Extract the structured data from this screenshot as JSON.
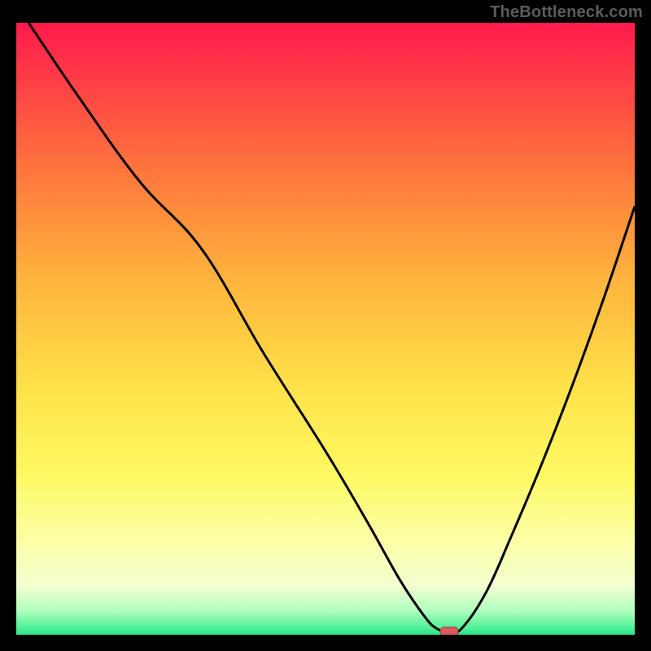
{
  "watermark": "TheBottleneck.com",
  "colors": {
    "bg_black": "#000000",
    "watermark_grey": "#5c5c5c",
    "curve": "#000000",
    "marker_fill": "#d85a5a",
    "marker_stroke": "#a83c3c",
    "grad_top": "#ff1a4d",
    "grad_mid1": "#ff6e3d",
    "grad_mid2": "#ffb43d",
    "grad_mid3": "#ffe24a",
    "grad_mid4": "#fff963",
    "grad_soft_yellow": "#fbffa8",
    "grad_pale": "#f3ffd0",
    "grad_green_soft": "#b2ffbf",
    "grad_green": "#29e888"
  },
  "chart_data": {
    "type": "line",
    "title": "",
    "xlabel": "",
    "ylabel": "",
    "xlim": [
      0,
      100
    ],
    "ylim": [
      0,
      100
    ],
    "x": [
      2,
      10,
      20,
      30,
      40,
      50,
      57,
      62,
      66,
      68,
      70,
      72,
      76,
      80,
      85,
      90,
      95,
      100
    ],
    "y": [
      100,
      88,
      74,
      63,
      46,
      30,
      18,
      9,
      3,
      1,
      0.5,
      1,
      7,
      16,
      28,
      41,
      55,
      70
    ],
    "marker": {
      "x": 70,
      "y": 0.5
    },
    "gradient_stops": [
      {
        "pos": 0.0,
        "key": "grad_top"
      },
      {
        "pos": 0.22,
        "key": "grad_mid1"
      },
      {
        "pos": 0.42,
        "key": "grad_mid2"
      },
      {
        "pos": 0.6,
        "key": "grad_mid3"
      },
      {
        "pos": 0.74,
        "key": "grad_mid4"
      },
      {
        "pos": 0.85,
        "key": "grad_soft_yellow"
      },
      {
        "pos": 0.92,
        "key": "grad_pale"
      },
      {
        "pos": 0.96,
        "key": "grad_green_soft"
      },
      {
        "pos": 1.0,
        "key": "grad_green"
      }
    ]
  }
}
